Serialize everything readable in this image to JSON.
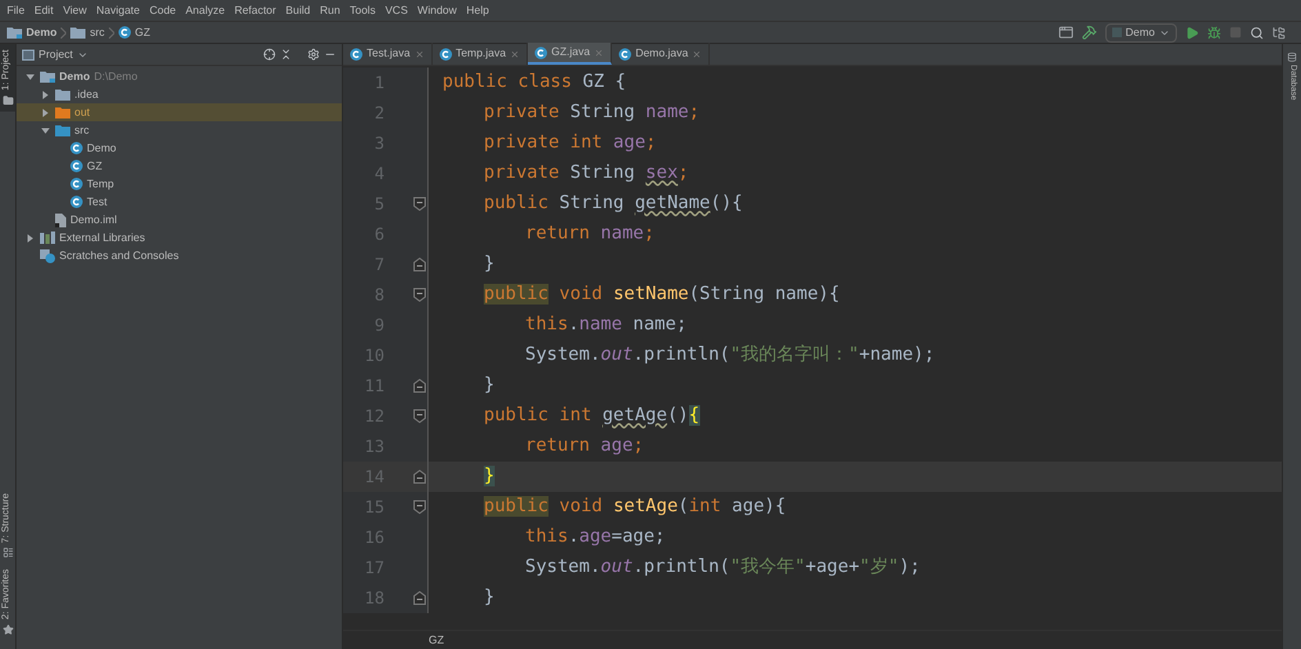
{
  "menu": [
    "File",
    "Edit",
    "View",
    "Navigate",
    "Code",
    "Analyze",
    "Refactor",
    "Build",
    "Run",
    "Tools",
    "VCS",
    "Window",
    "Help"
  ],
  "breadcrumb": [
    {
      "label": "Demo",
      "kind": "project"
    },
    {
      "label": "src",
      "kind": "folder"
    },
    {
      "label": "GZ",
      "kind": "class"
    }
  ],
  "toolbar": {
    "run_config": "Demo"
  },
  "left_strip": [
    {
      "label": "1: Project",
      "selected": true,
      "kind": "folder"
    },
    {
      "label": "7: Structure",
      "selected": false,
      "kind": "structure"
    },
    {
      "label": "2: Favorites",
      "selected": false,
      "kind": "star"
    }
  ],
  "right_strip": [
    {
      "label": "Database"
    }
  ],
  "project_panel": {
    "title": "Project",
    "tree": [
      {
        "label": "Demo",
        "path": "D:\\Demo",
        "kind": "project",
        "expanded": true,
        "selected": false,
        "children": [
          {
            "label": ".idea",
            "kind": "folder",
            "expanded": false,
            "selected": false
          },
          {
            "label": "out",
            "kind": "folder-excluded",
            "expanded": false,
            "selected": true
          },
          {
            "label": "src",
            "kind": "folder-source",
            "expanded": true,
            "selected": false,
            "children": [
              {
                "label": "Demo",
                "kind": "class",
                "selected": false
              },
              {
                "label": "GZ",
                "kind": "class",
                "selected": false
              },
              {
                "label": "Temp",
                "kind": "class",
                "selected": false
              },
              {
                "label": "Test",
                "kind": "class",
                "selected": false
              }
            ]
          },
          {
            "label": "Demo.iml",
            "kind": "iml",
            "selected": false
          }
        ]
      },
      {
        "label": "External Libraries",
        "kind": "library",
        "expanded": false,
        "selected": false
      },
      {
        "label": "Scratches and Consoles",
        "kind": "scratches",
        "selected": false
      }
    ]
  },
  "tabs": [
    {
      "label": "Test.java",
      "selected": false
    },
    {
      "label": "Temp.java",
      "selected": false
    },
    {
      "label": "GZ.java",
      "selected": true
    },
    {
      "label": "Demo.java",
      "selected": false
    }
  ],
  "editor": {
    "lines": [
      {
        "number": "1",
        "current": false,
        "fold_open": false,
        "fold_close": false,
        "tokens": [
          {
            "t": "public class ",
            "kind": "keyword"
          },
          {
            "t": "GZ {",
            "kind": "plain"
          }
        ]
      },
      {
        "number": "2",
        "current": false,
        "fold_open": false,
        "fold_close": false,
        "tokens": [
          {
            "t": "private ",
            "kind": "keyword"
          },
          {
            "t": "String ",
            "kind": "plain"
          },
          {
            "t": "name",
            "kind": "field"
          },
          {
            "t": ";",
            "kind": "keyword"
          }
        ]
      },
      {
        "number": "3",
        "current": false,
        "fold_open": false,
        "fold_close": false,
        "tokens": [
          {
            "t": "private int ",
            "kind": "keyword"
          },
          {
            "t": "age",
            "kind": "field"
          },
          {
            "t": ";",
            "kind": "keyword"
          }
        ]
      },
      {
        "number": "4",
        "current": false,
        "fold_open": false,
        "fold_close": false,
        "tokens": [
          {
            "t": "private ",
            "kind": "keyword"
          },
          {
            "t": "String ",
            "kind": "plain"
          },
          {
            "t": "sex",
            "kind": "field",
            "warning": true
          },
          {
            "t": ";",
            "kind": "keyword"
          }
        ]
      },
      {
        "number": "5",
        "current": false,
        "fold_open": true,
        "fold_close": false,
        "tokens": [
          {
            "t": "public ",
            "kind": "keyword"
          },
          {
            "t": "String ",
            "kind": "plain"
          },
          {
            "t": "getName",
            "kind": "plain",
            "warning": true
          },
          {
            "t": "(){",
            "kind": "plain"
          }
        ]
      },
      {
        "number": "6",
        "current": false,
        "fold_open": false,
        "fold_close": false,
        "tokens": [
          {
            "t": "return ",
            "kind": "keyword"
          },
          {
            "t": "name",
            "kind": "field"
          },
          {
            "t": ";",
            "kind": "keyword"
          }
        ]
      },
      {
        "number": "7",
        "current": false,
        "fold_open": false,
        "fold_close": true,
        "tokens": [
          {
            "t": "}",
            "kind": "plain"
          }
        ]
      },
      {
        "number": "8",
        "current": false,
        "fold_open": true,
        "fold_close": false,
        "tokens": [
          {
            "t": "public",
            "kind": "keyword",
            "highlight": true
          },
          {
            "t": " void ",
            "kind": "keyword"
          },
          {
            "t": "setName",
            "kind": "method"
          },
          {
            "t": "(String name){",
            "kind": "plain"
          }
        ]
      },
      {
        "number": "9",
        "current": false,
        "fold_open": false,
        "fold_close": false,
        "tokens": [
          {
            "t": "this",
            "kind": "keyword"
          },
          {
            "t": ".",
            "kind": "plain"
          },
          {
            "t": "name",
            "kind": "field"
          },
          {
            "t": " name;",
            "kind": "plain"
          }
        ]
      },
      {
        "number": "10",
        "current": false,
        "fold_open": false,
        "fold_close": false,
        "tokens": [
          {
            "t": "System.",
            "kind": "plain"
          },
          {
            "t": "out",
            "kind": "static"
          },
          {
            "t": ".println(",
            "kind": "plain"
          },
          {
            "t": "\"我的名字叫：\"",
            "kind": "string"
          },
          {
            "t": "+name);",
            "kind": "plain"
          }
        ]
      },
      {
        "number": "11",
        "current": false,
        "fold_open": false,
        "fold_close": true,
        "tokens": [
          {
            "t": "}",
            "kind": "plain"
          }
        ]
      },
      {
        "number": "12",
        "current": false,
        "fold_open": true,
        "fold_close": false,
        "tokens": [
          {
            "t": "public int ",
            "kind": "keyword"
          },
          {
            "t": "getAge",
            "kind": "plain",
            "warning": true
          },
          {
            "t": "()",
            "kind": "plain"
          },
          {
            "t": "{",
            "kind": "plain",
            "match": true
          }
        ]
      },
      {
        "number": "13",
        "current": false,
        "fold_open": false,
        "fold_close": false,
        "tokens": [
          {
            "t": "return ",
            "kind": "keyword"
          },
          {
            "t": "age",
            "kind": "field"
          },
          {
            "t": ";",
            "kind": "keyword"
          }
        ]
      },
      {
        "number": "14",
        "current": true,
        "fold_open": false,
        "fold_close": true,
        "tokens": [
          {
            "t": "}",
            "kind": "plain",
            "match": true
          }
        ]
      },
      {
        "number": "15",
        "current": false,
        "fold_open": true,
        "fold_close": false,
        "tokens": [
          {
            "t": "public",
            "kind": "keyword",
            "highlight": true
          },
          {
            "t": " void ",
            "kind": "keyword"
          },
          {
            "t": "setAge",
            "kind": "method"
          },
          {
            "t": "(",
            "kind": "plain"
          },
          {
            "t": "int ",
            "kind": "keyword"
          },
          {
            "t": "age){",
            "kind": "plain"
          }
        ]
      },
      {
        "number": "16",
        "current": false,
        "fold_open": false,
        "fold_close": false,
        "tokens": [
          {
            "t": "this",
            "kind": "keyword"
          },
          {
            "t": ".",
            "kind": "plain"
          },
          {
            "t": "age",
            "kind": "field"
          },
          {
            "t": "=age;",
            "kind": "plain"
          }
        ]
      },
      {
        "number": "17",
        "current": false,
        "fold_open": false,
        "fold_close": false,
        "tokens": [
          {
            "t": "System.",
            "kind": "plain"
          },
          {
            "t": "out",
            "kind": "static"
          },
          {
            "t": ".println(",
            "kind": "plain"
          },
          {
            "t": "\"我今年\"",
            "kind": "string"
          },
          {
            "t": "+age+",
            "kind": "plain"
          },
          {
            "t": "\"岁\"",
            "kind": "string"
          },
          {
            "t": ");",
            "kind": "plain"
          }
        ]
      },
      {
        "number": "18",
        "current": false,
        "fold_open": false,
        "fold_close": true,
        "tokens": [
          {
            "t": "}",
            "kind": "plain"
          }
        ]
      }
    ],
    "breadcrumb": "GZ"
  }
}
